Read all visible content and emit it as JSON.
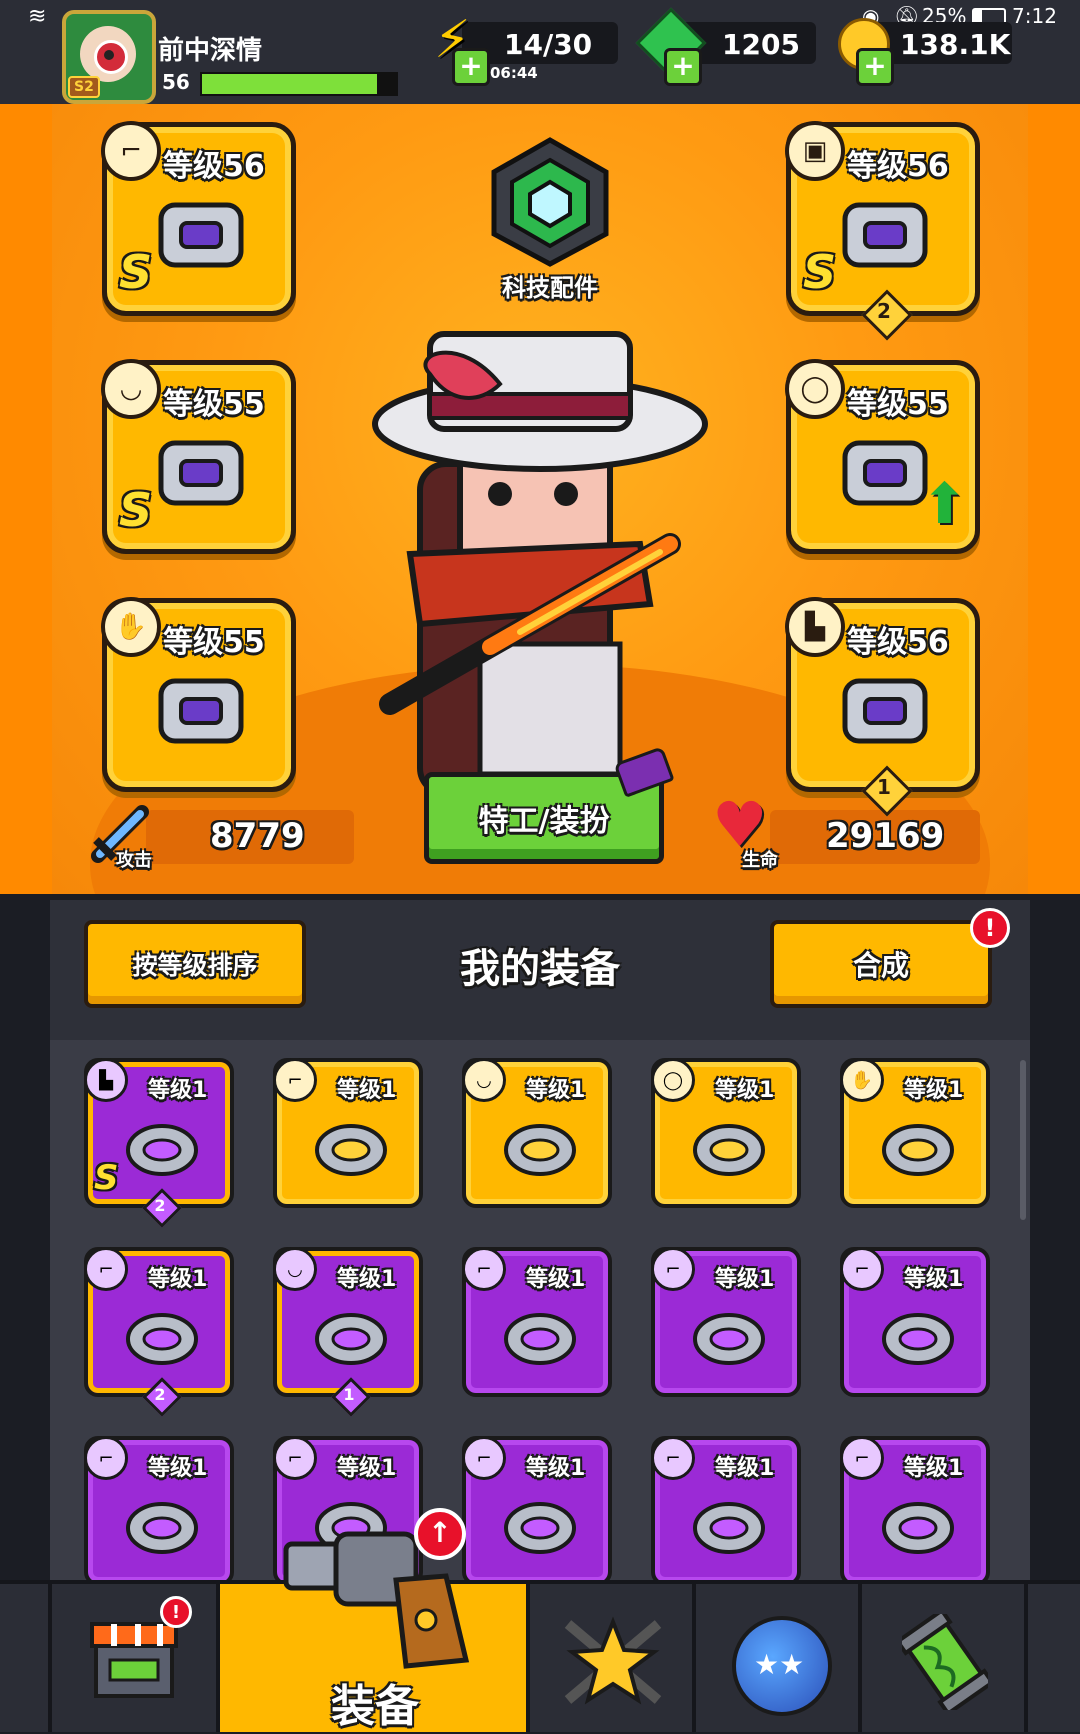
{
  "status_bar": {
    "battery": "25%",
    "time": "7:12"
  },
  "player": {
    "name": "前中深情",
    "level": "56",
    "season": "S2",
    "xp_fraction": 0.9
  },
  "resources": {
    "energy": {
      "value": "14/30",
      "timer": "06:44"
    },
    "gems": {
      "value": "1205"
    },
    "coins": {
      "value": "138.1K"
    }
  },
  "hero": {
    "tech_part_label": "科技配件",
    "outfit_button": "特工/装扮",
    "attack": {
      "label": "攻击",
      "value": "8779"
    },
    "health": {
      "label": "生命",
      "value": "29169"
    },
    "slots": [
      {
        "level": "等级56",
        "rank": "S",
        "icon": "weapon-icon",
        "item": "sword-item"
      },
      {
        "level": "等级55",
        "rank": "S",
        "icon": "necklace-icon",
        "item": "ring-item"
      },
      {
        "level": "等级55",
        "rank": "",
        "icon": "glove-icon",
        "item": "gauntlet-item"
      },
      {
        "level": "等级56",
        "rank": "S",
        "icon": "armor-icon",
        "item": "armor-item",
        "badge": "2"
      },
      {
        "level": "等级55",
        "rank": "",
        "icon": "belt-icon",
        "item": "belt-item",
        "upgrade": true
      },
      {
        "level": "等级56",
        "rank": "",
        "icon": "boots-icon",
        "item": "boots-item",
        "badge": "1"
      }
    ]
  },
  "equipment": {
    "title": "我的装备",
    "sort_button": "按等级排序",
    "merge_button": "合成",
    "merge_alert": "!",
    "items": [
      {
        "level": "等级1",
        "style": "po",
        "rank": "S",
        "badge": "2",
        "type": "boots"
      },
      {
        "level": "等级1",
        "style": "y",
        "rank": "",
        "badge": "",
        "type": "kunai"
      },
      {
        "level": "等级1",
        "style": "y",
        "rank": "",
        "badge": "",
        "type": "spiked-collar"
      },
      {
        "level": "等级1",
        "style": "y",
        "rank": "",
        "badge": "",
        "type": "belt"
      },
      {
        "level": "等级1",
        "style": "y",
        "rank": "",
        "badge": "",
        "type": "glove"
      },
      {
        "level": "等级1",
        "style": "po",
        "rank": "",
        "badge": "2",
        "type": "kunai"
      },
      {
        "level": "等级1",
        "style": "po",
        "rank": "",
        "badge": "1",
        "type": "fang-necklace"
      },
      {
        "level": "等级1",
        "style": "p",
        "rank": "",
        "badge": "",
        "type": "kunai"
      },
      {
        "level": "等级1",
        "style": "p",
        "rank": "",
        "badge": "",
        "type": "kunai"
      },
      {
        "level": "等级1",
        "style": "p",
        "rank": "",
        "badge": "",
        "type": "kunai"
      },
      {
        "level": "等级1",
        "style": "p",
        "rank": "",
        "badge": "",
        "type": "drill"
      },
      {
        "level": "等级1",
        "style": "p",
        "rank": "",
        "badge": "",
        "type": "drill"
      },
      {
        "level": "等级1",
        "style": "p",
        "rank": "",
        "badge": "",
        "type": "drill"
      },
      {
        "level": "等级1",
        "style": "p",
        "rank": "",
        "badge": "",
        "type": "drill"
      },
      {
        "level": "等级1",
        "style": "p",
        "rank": "",
        "badge": "",
        "type": "drill"
      }
    ]
  },
  "nav": {
    "shop_alert": "!",
    "equipment_label": "装备"
  },
  "colors": {
    "accent_orange": "#ff9a12",
    "gold": "#ffb800",
    "purple": "#9b2ad6",
    "green_button": "#6cd13a"
  }
}
